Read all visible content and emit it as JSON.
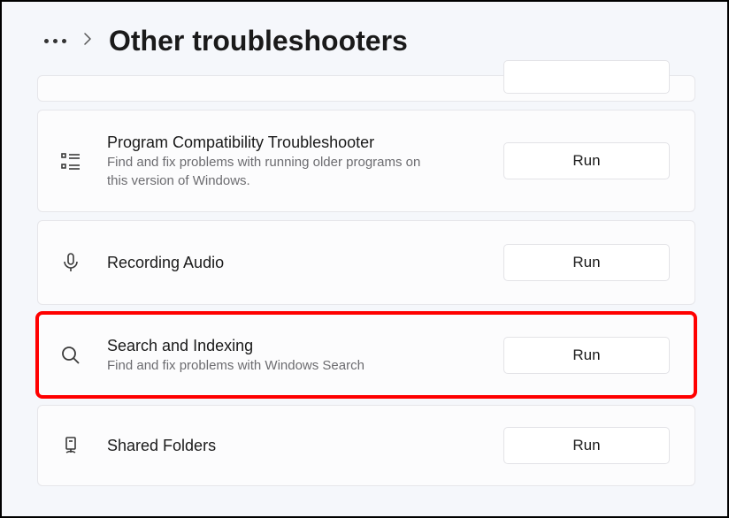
{
  "header": {
    "title": "Other troubleshooters"
  },
  "items": [
    {
      "title": "Program Compatibility Troubleshooter",
      "desc": "Find and fix problems with running older programs on this version of Windows.",
      "button": "Run"
    },
    {
      "title": "Recording Audio",
      "desc": "",
      "button": "Run"
    },
    {
      "title": "Search and Indexing",
      "desc": "Find and fix problems with Windows Search",
      "button": "Run"
    },
    {
      "title": "Shared Folders",
      "desc": "",
      "button": "Run"
    }
  ]
}
